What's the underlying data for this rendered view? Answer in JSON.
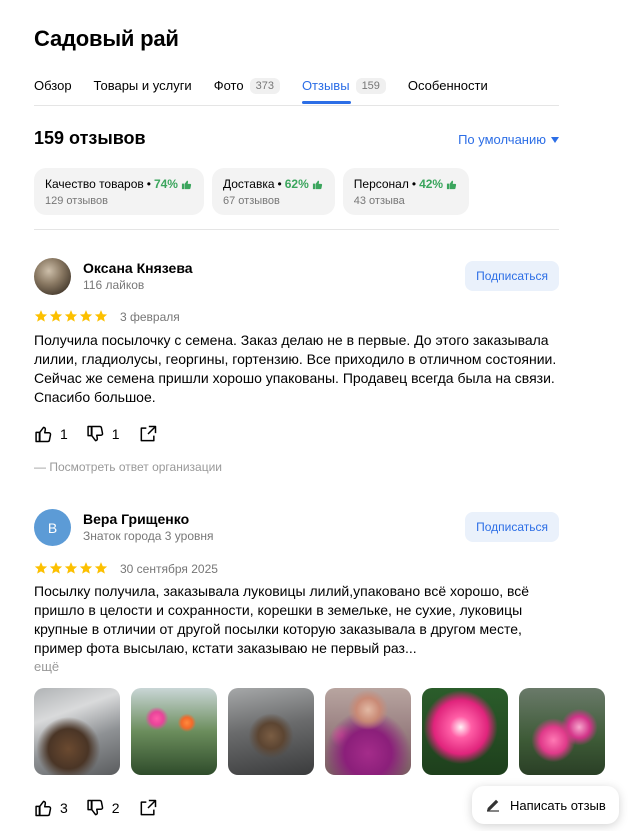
{
  "header": {
    "title": "Садовый рай"
  },
  "tabs": [
    {
      "label": "Обзор"
    },
    {
      "label": "Товары и услуги"
    },
    {
      "label": "Фото",
      "count": "373"
    },
    {
      "label": "Отзывы",
      "count": "159",
      "active": true
    },
    {
      "label": "Особенности"
    }
  ],
  "reviews_header": {
    "title": "159 отзывов",
    "sort_label": "По умолчанию"
  },
  "aspects": [
    {
      "name": "Качество товаров",
      "percent": "74%",
      "reviews": "129 отзывов"
    },
    {
      "name": "Доставка",
      "percent": "62%",
      "reviews": "67 отзывов"
    },
    {
      "name": "Персонал",
      "percent": "42%",
      "reviews": "43 отзыва"
    }
  ],
  "reviews": [
    {
      "author": "Оксана Князева",
      "subtitle": "116 лайков",
      "subscribe_label": "Подписаться",
      "rating": 5,
      "date": "3 февраля",
      "text": "Получила посылочку с семена. Заказ делаю не в первые. До этого заказывала лилии, гладиолусы, георгины, гортензию. Все приходило в отличном состоянии. Сейчас же семена пришли хорошо упакованы. Продавец всегда была на связи. Спасибо большое.",
      "likes": "1",
      "dislikes": "1",
      "org_reply_label": "— Посмотреть ответ организации"
    },
    {
      "author": "Вера Грищенко",
      "avatar_letter": "В",
      "subtitle": "Знаток города 3 уровня",
      "subscribe_label": "Подписаться",
      "rating": 5,
      "date": "30 сентября 2025",
      "text": "Посылку получила, заказывала луковицы лилий,упаковано всё хорошо, всё пришло в целости и сохранности, корешки в земельке, не сухие, луковицы крупные в отличии от другой посылки которую заказывала в другом месте, пример фота высылаю, кстати заказываю не первый раз...",
      "more_label": "ещё",
      "likes": "3",
      "dislikes": "2"
    }
  ],
  "write_review": {
    "label": "Написать отзыв"
  },
  "colors": {
    "accent": "#2c6ee6",
    "positive": "#3ba55d",
    "star": "#fcc000"
  }
}
